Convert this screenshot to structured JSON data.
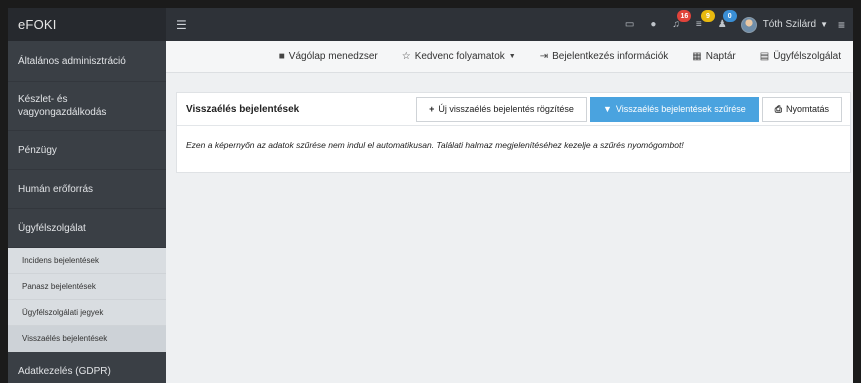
{
  "app": {
    "title": "eFOKI"
  },
  "topbar": {
    "badges": {
      "notifications": "16",
      "messages": "9",
      "users": "0"
    },
    "user_name": "Tóth Szilárd"
  },
  "sidebar": {
    "items": [
      {
        "label": "Általános adminisztráció"
      },
      {
        "label": "Készlet- és vagyongazdálkodás"
      },
      {
        "label": "Pénzügy"
      },
      {
        "label": "Humán erőforrás"
      },
      {
        "label": "Ügyfélszolgálat"
      }
    ],
    "sub_items": [
      {
        "label": "Incidens bejelentések"
      },
      {
        "label": "Panasz bejelentések"
      },
      {
        "label": "Ügyfélszolgálati jegyek"
      },
      {
        "label": "Visszaélés bejelentések"
      }
    ],
    "partial_item": {
      "label": "Adatkezelés (GDPR)"
    }
  },
  "subnav": {
    "clipboard": "Vágólap menedzser",
    "favorites": "Kedvenc folyamatok",
    "login_info": "Bejelentkezés információk",
    "calendar": "Naptár",
    "support": "Ügyfélszolgálat"
  },
  "panel": {
    "title": "Visszaélés bejelentések",
    "buttons": {
      "add": "Új visszaélés bejelentés rögzítése",
      "filter": "Visszaélés bejelentések szűrése",
      "print": "Nyomtatás"
    },
    "message": "Ezen a képernyőn az adatok szűrése nem indul el automatikusan. Találati halmaz megjelenítéséhez kezelje a szűrés nyomógombot!"
  },
  "colors": {
    "topbar": "#2e3238",
    "sidebar": "#3a3f45",
    "primary": "#4aa3df",
    "badge_red": "#e0433b",
    "badge_yellow": "#e8b90f",
    "badge_blue": "#3a8fd6"
  },
  "icons": [
    "monitor-icon",
    "globe-icon",
    "bell-icon",
    "envelope-icon",
    "users-icon",
    "clipboard-icon",
    "star-icon",
    "sign-in-icon",
    "calendar-icon",
    "chat-icon",
    "plus-icon",
    "filter-icon",
    "print-icon",
    "hamburger-icon"
  ]
}
